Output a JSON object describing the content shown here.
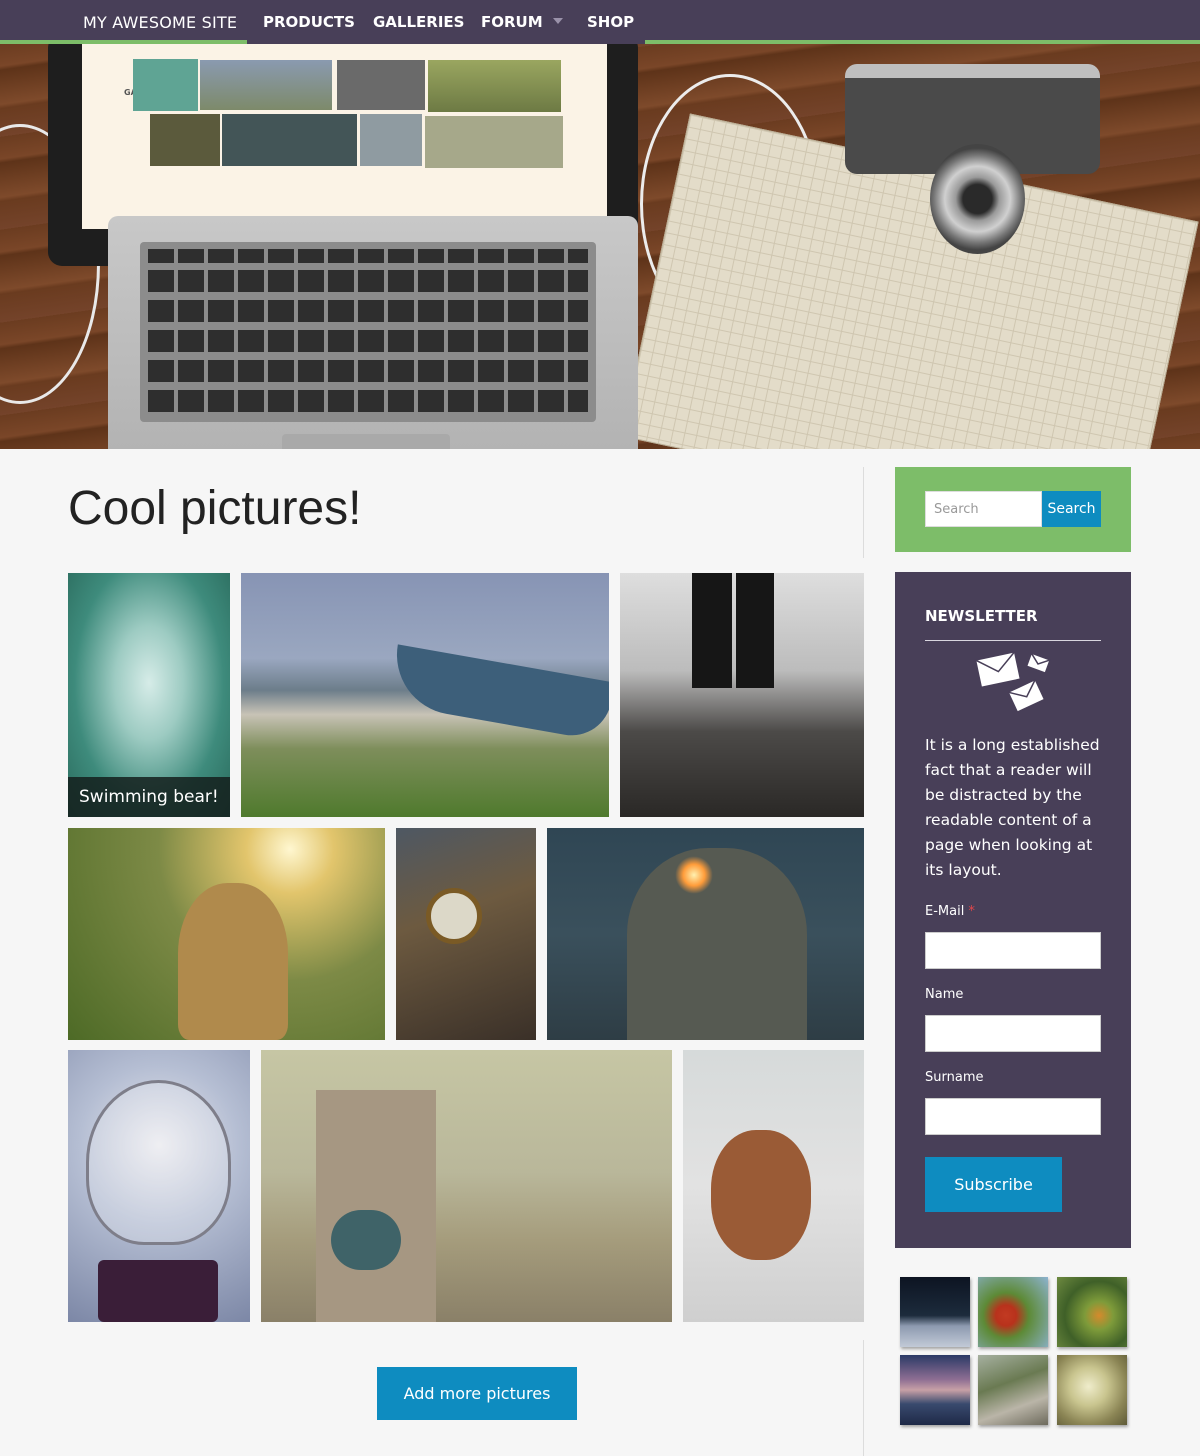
{
  "nav": {
    "brand": "MY AWESOME SITE",
    "items": [
      {
        "label": "PRODUCTS"
      },
      {
        "label": "GALLERIES"
      },
      {
        "label": "FORUM",
        "has_dropdown": true
      },
      {
        "label": "SHOP"
      }
    ]
  },
  "hero": {
    "screen_label": "GALLERY"
  },
  "main": {
    "title": "Cool pictures!",
    "gallery": [
      {
        "caption": "Swimming bear!",
        "subject": "polar bear"
      },
      {
        "subject": "boat on beach"
      },
      {
        "subject": "legs on rocky beach"
      },
      {
        "subject": "girl in field"
      },
      {
        "subject": "big ben clock"
      },
      {
        "subject": "woman with sparkler"
      },
      {
        "subject": "light bulb"
      },
      {
        "subject": "lighthouse with binoculars"
      },
      {
        "subject": "dog"
      }
    ],
    "add_more_label": "Add more pictures"
  },
  "sidebar": {
    "search": {
      "placeholder": "Search",
      "button_label": "Search"
    },
    "newsletter": {
      "title": "NEWSLETTER",
      "text": "It is a long established fact that a reader will be distracted by the readable content of a page when looking at its layout.",
      "fields": [
        {
          "label": "E-Mail",
          "required": true,
          "required_mark": "*"
        },
        {
          "label": "Name",
          "required": false
        },
        {
          "label": "Surname",
          "required": false
        }
      ],
      "subscribe_label": "Subscribe"
    },
    "mini_gallery": [
      {
        "subject": "night snow"
      },
      {
        "subject": "red berries"
      },
      {
        "subject": "butterfly on plant"
      },
      {
        "subject": "mountain sunset"
      },
      {
        "subject": "rocky path"
      },
      {
        "subject": "misty forest"
      }
    ]
  },
  "colors": {
    "nav_bg": "#483f58",
    "accent_green": "#7dbd69",
    "button_blue": "#0e8cc0",
    "newsletter_bg": "#483f58",
    "required": "#e2474a"
  }
}
